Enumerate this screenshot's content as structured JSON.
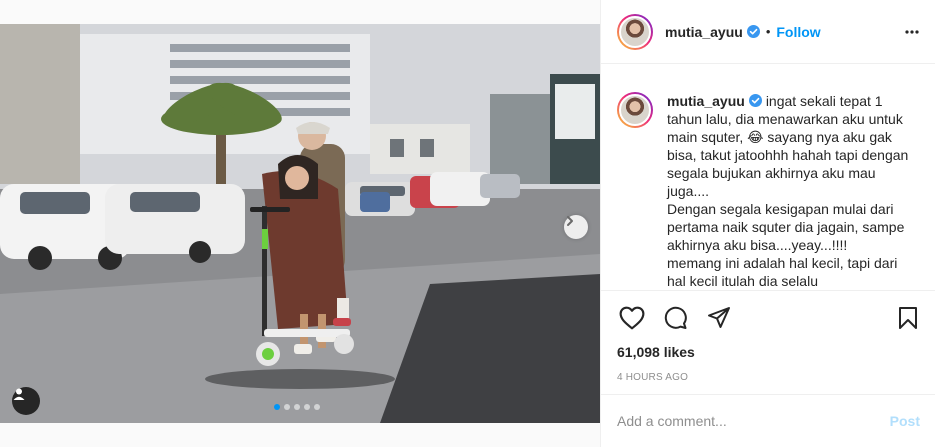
{
  "post": {
    "username": "mutia_ayuu",
    "separator": "•",
    "follow_label": "Follow",
    "caption_lines": [
      "ingat sekali tepat 1 tahun lalu, dia menawarkan aku untuk main squter, 😂 sayang nya aku gak bisa, takut jatoohhh hahah tapi dengan segala bujukan akhirnya aku mau juga....",
      "Dengan segala kesigapan mulai dari pertama naik squter dia jagain, sampe akhirnya aku bisa....yeay...!!!!",
      "memang ini adalah hal kecil, tapi dari hal kecil itulah dia selalu"
    ],
    "likes": "61,098 likes",
    "time": "4 HOURS AGO",
    "comment_placeholder": "Add a comment...",
    "post_label": "Post"
  },
  "carousel": {
    "count": 5,
    "active_index": 0
  },
  "icons": {
    "more": "more-icon",
    "like": "heart-icon",
    "comment": "comment-icon",
    "share": "share-icon",
    "save": "bookmark-icon",
    "next": "chevron-right-icon",
    "tag": "user-tag-icon",
    "verified": "verified-badge-icon"
  },
  "colors": {
    "accent": "#0095f6",
    "post_disabled": "#b2dffc",
    "muted": "#8e8e8e",
    "text": "#262626"
  }
}
